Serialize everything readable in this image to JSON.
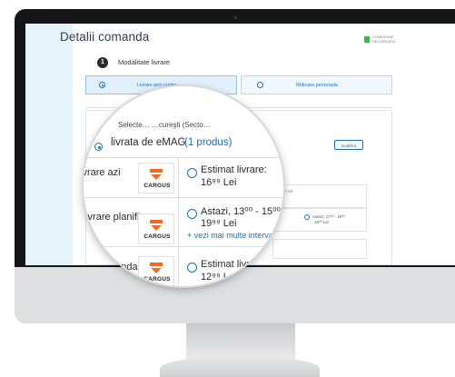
{
  "page": {
    "title": "Detalii comanda",
    "secure_badge": "CONEXIUNE SECURIZATA"
  },
  "step": {
    "number": "1",
    "label": "Modalitate livrare"
  },
  "delivery_options": [
    {
      "label": "Livrare prin curier",
      "selected": true
    },
    {
      "label": "Ridicare personala",
      "selected": false
    }
  ],
  "card": {
    "select_city_label": "Selecteaza: Bucuresti (Sector...)",
    "modify_button": "modifica",
    "small_time_green": "17:00",
    "small_slot_a": "Astazi, 17⁰⁰ - 19⁰⁰",
    "small_slot_b": "19⁰⁰ Lei"
  },
  "lens": {
    "header_prefix": "livrata de eMAG",
    "header_link": "(1 produs)",
    "select_partial": "Selecte… …cureşti (Secto…",
    "courier_label": "CARGUS",
    "rows": [
      {
        "label": "ivrare azi",
        "line1": "Estimat livrare:",
        "price": "16⁹⁹ Lei"
      },
      {
        "label": "Livrare planific",
        "line1": "Astazi, 13⁰⁰ - 15⁰⁰",
        "price": "19⁹⁹ Lei",
        "link": "+ vezi mai multe interva"
      },
      {
        "label": "ivrare standa",
        "line1": "Estimat livrare:",
        "price": "12⁹⁹ Lei"
      }
    ]
  },
  "colors": {
    "accent": "#1a6fb5",
    "brand_orange": "#f26a21",
    "secure_green": "#3bb54a"
  }
}
